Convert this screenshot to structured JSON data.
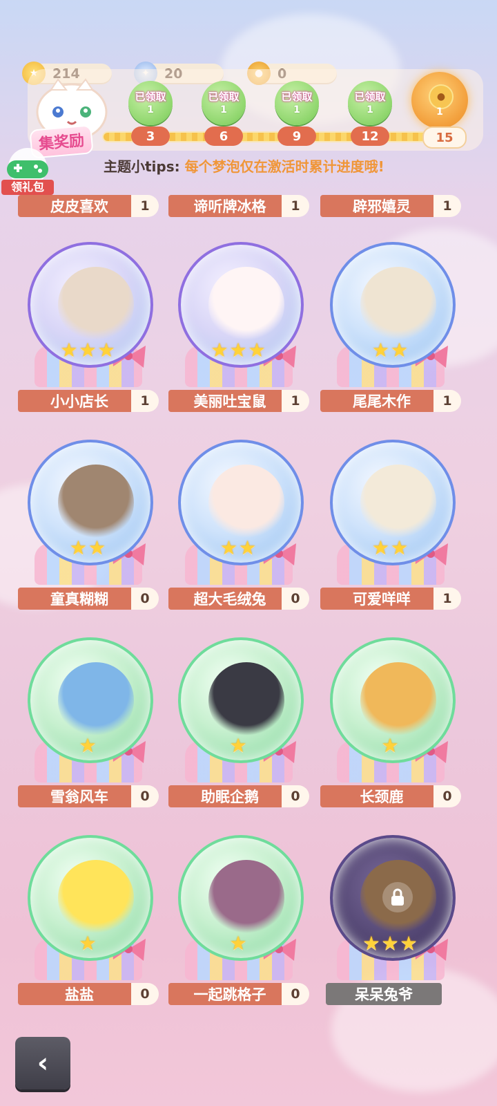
{
  "currencies": [
    {
      "icon": "gold-star-coin-icon",
      "value": "214"
    },
    {
      "icon": "blue-gem-icon",
      "value": "20"
    },
    {
      "icon": "gold-coin-icon",
      "value": "0"
    }
  ],
  "rewards": {
    "title": "集奖励",
    "claimed_label": "已领取",
    "milestones": [
      {
        "count": "3",
        "amount": "1",
        "status": "claimed"
      },
      {
        "count": "6",
        "amount": "1",
        "status": "claimed"
      },
      {
        "count": "9",
        "amount": "1",
        "status": "claimed"
      },
      {
        "count": "12",
        "amount": "1",
        "status": "claimed"
      },
      {
        "count": "15",
        "amount": "1",
        "status": "available"
      }
    ]
  },
  "gift": {
    "label": "领礼包"
  },
  "tips": {
    "prefix": "主题小tips:",
    "text": "每个梦泡仅在激活时累计进度哦!"
  },
  "partial_row": [
    {
      "name": "皮皮喜欢",
      "count": "1"
    },
    {
      "name": "谛听牌冰格",
      "count": "1"
    },
    {
      "name": "辟邪嬉灵",
      "count": "1"
    }
  ],
  "cards": [
    {
      "name": "小小店长",
      "count": "1",
      "stars": 3,
      "bubble": "purple",
      "color": "#e9d9c9"
    },
    {
      "name": "美丽吐宝鼠",
      "count": "1",
      "stars": 3,
      "bubble": "purple",
      "color": "#fff5f5"
    },
    {
      "name": "尾尾木作",
      "count": "1",
      "stars": 2,
      "bubble": "blue",
      "color": "#efe4d2"
    },
    {
      "name": "童真糊糊",
      "count": "0",
      "stars": 2,
      "bubble": "blue",
      "color": "#a08670"
    },
    {
      "name": "超大毛绒兔",
      "count": "0",
      "stars": 2,
      "bubble": "blue",
      "color": "#fbe9e2"
    },
    {
      "name": "可爱咩咩",
      "count": "1",
      "stars": 2,
      "bubble": "blue",
      "color": "#f3ead9"
    },
    {
      "name": "雪翁风车",
      "count": "0",
      "stars": 1,
      "bubble": "green",
      "color": "#7fb6e8"
    },
    {
      "name": "助眠企鹅",
      "count": "0",
      "stars": 1,
      "bubble": "green",
      "color": "#3a3a44"
    },
    {
      "name": "长颈鹿",
      "count": "0",
      "stars": 1,
      "bubble": "green",
      "color": "#f0b85a"
    },
    {
      "name": "盐盐",
      "count": "0",
      "stars": 1,
      "bubble": "green",
      "color": "#ffe45a"
    },
    {
      "name": "一起跳格子",
      "count": "0",
      "stars": 1,
      "bubble": "green",
      "color": "#9a6a8a"
    },
    {
      "name": "呆呆兔爷",
      "count": "",
      "stars": 3,
      "bubble": "locked",
      "color": "#8b6a4a"
    }
  ],
  "back": {
    "icon": "back-arrow-icon"
  }
}
